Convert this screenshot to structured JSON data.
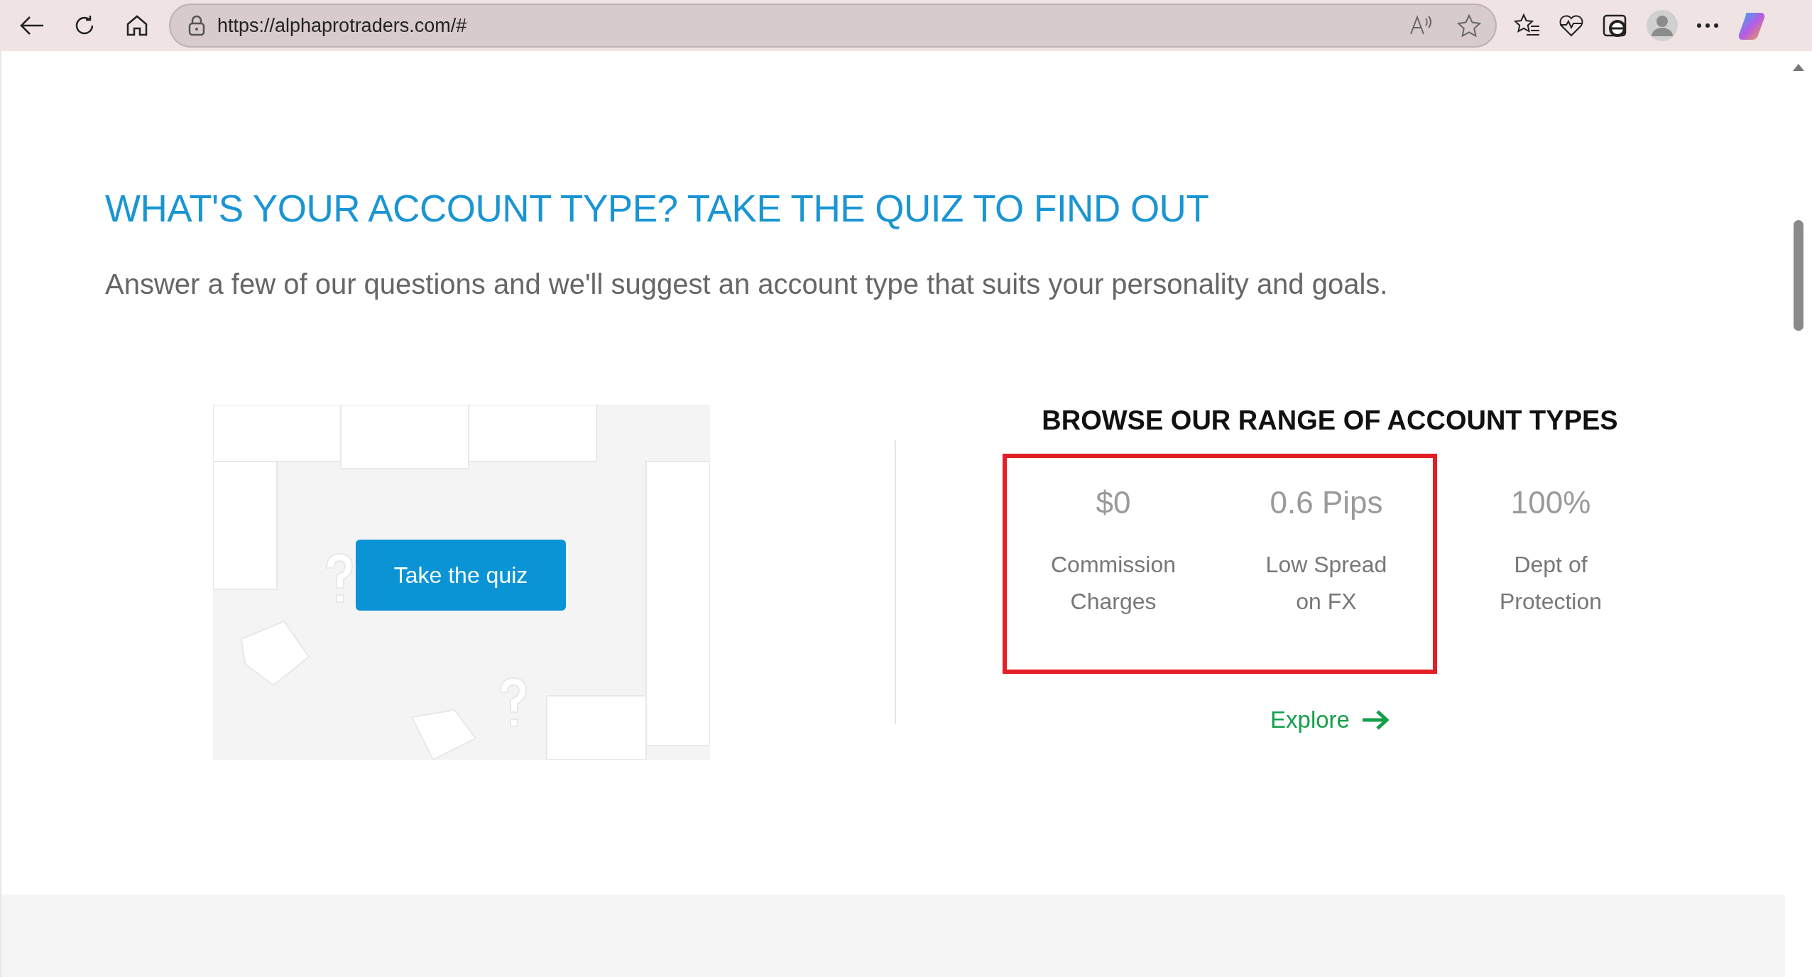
{
  "browser": {
    "url": "https://alphaprotraders.com/#"
  },
  "quiz": {
    "heading": "WHAT'S YOUR ACCOUNT TYPE? TAKE THE QUIZ TO FIND OUT",
    "subtitle": "Answer a few of our questions and we'll suggest an account type that suits your personality and goals.",
    "button": "Take the quiz"
  },
  "account_types": {
    "heading": "BROWSE OUR RANGE OF ACCOUNT TYPES",
    "stats": [
      {
        "value": "$0",
        "label": "Commission Charges",
        "highlighted": true
      },
      {
        "value": "0.6 Pips",
        "label": "Low Spread on FX",
        "highlighted": true
      },
      {
        "value": "100%",
        "label": "Dept of Protection",
        "highlighted": false
      }
    ],
    "link": "Explore"
  }
}
